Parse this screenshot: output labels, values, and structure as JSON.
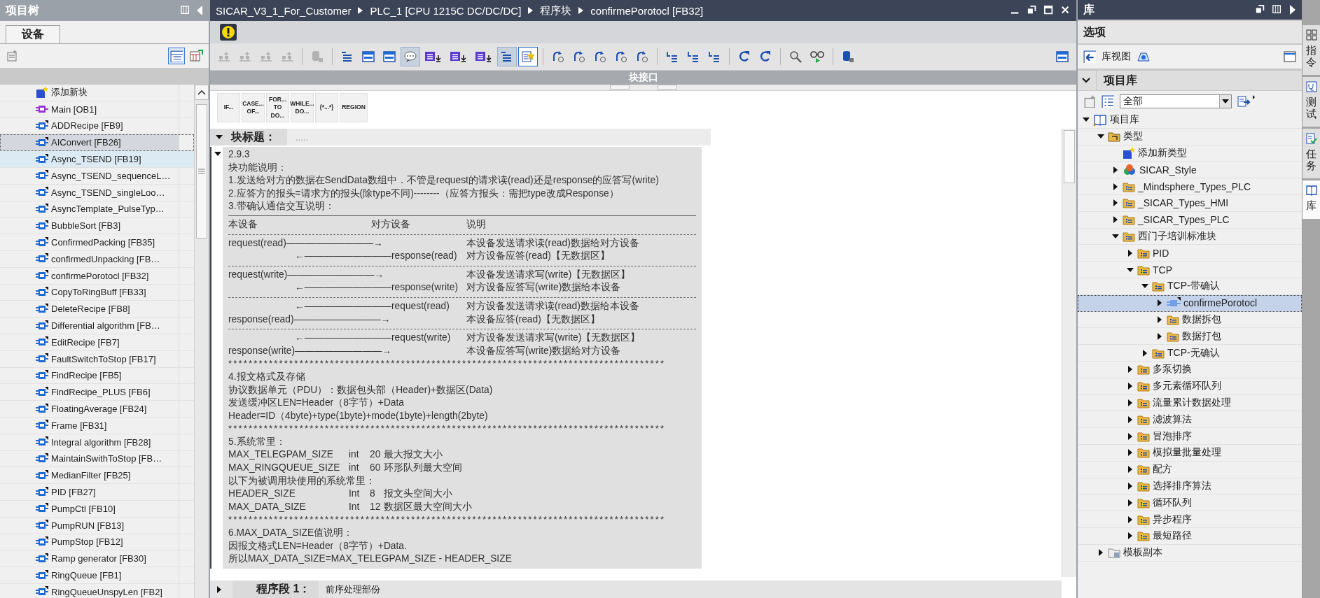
{
  "project_tree": {
    "title": "项目树",
    "tabs": [
      {
        "label": "设备",
        "selected": true
      }
    ],
    "items": [
      {
        "kind": "add",
        "label": "添加新块",
        "selected": false,
        "highlighted": false
      },
      {
        "kind": "ob",
        "label": "Main [OB1]",
        "selected": false,
        "highlighted": false
      },
      {
        "kind": "fb",
        "label": "ADDRecipe [FB9]",
        "selected": false,
        "highlighted": false
      },
      {
        "kind": "fb",
        "label": "AIConvert [FB26]",
        "selected": true,
        "highlighted": false
      },
      {
        "kind": "fb",
        "label": "Async_TSEND [FB19]",
        "selected": false,
        "highlighted": true
      },
      {
        "kind": "fb",
        "label": "Async_TSEND_sequenceL…",
        "selected": false,
        "highlighted": false
      },
      {
        "kind": "fb",
        "label": "Async_TSEND_singleLoo…",
        "selected": false,
        "highlighted": false
      },
      {
        "kind": "fb",
        "label": "AsyncTemplate_PulseTyp…",
        "selected": false,
        "highlighted": false
      },
      {
        "kind": "fb",
        "label": "BubbleSort [FB3]",
        "selected": false,
        "highlighted": false
      },
      {
        "kind": "fb",
        "label": "ConfirmedPacking [FB35]",
        "selected": false,
        "highlighted": false
      },
      {
        "kind": "fb",
        "label": "confirmedUnpacking [FB…",
        "selected": false,
        "highlighted": false
      },
      {
        "kind": "fb",
        "label": "confirmePorotocl [FB32]",
        "selected": false,
        "highlighted": false
      },
      {
        "kind": "fb",
        "label": "CopyToRingBuff [FB33]",
        "selected": false,
        "highlighted": false
      },
      {
        "kind": "fb",
        "label": "DeleteRecipe [FB8]",
        "selected": false,
        "highlighted": false
      },
      {
        "kind": "fb",
        "label": "Differential algorithm [FB…",
        "selected": false,
        "highlighted": false
      },
      {
        "kind": "fb",
        "label": "EditRecipe [FB7]",
        "selected": false,
        "highlighted": false
      },
      {
        "kind": "fb",
        "label": "FaultSwitchToStop [FB17]",
        "selected": false,
        "highlighted": false
      },
      {
        "kind": "fb",
        "label": "FindRecipe [FB5]",
        "selected": false,
        "highlighted": false
      },
      {
        "kind": "fb",
        "label": "FindRecipe_PLUS [FB6]",
        "selected": false,
        "highlighted": false
      },
      {
        "kind": "fb",
        "label": "FloatingAverage [FB24]",
        "selected": false,
        "highlighted": false
      },
      {
        "kind": "fb",
        "label": "Frame [FB31]",
        "selected": false,
        "highlighted": false
      },
      {
        "kind": "fb",
        "label": "Integral algorithm [FB28]",
        "selected": false,
        "highlighted": false
      },
      {
        "kind": "fb",
        "label": "MaintainSwithToStop [FB…",
        "selected": false,
        "highlighted": false
      },
      {
        "kind": "fb",
        "label": "MedianFilter [FB25]",
        "selected": false,
        "highlighted": false
      },
      {
        "kind": "fb",
        "label": "PID [FB27]",
        "selected": false,
        "highlighted": false
      },
      {
        "kind": "fb",
        "label": "PumpCtl [FB10]",
        "selected": false,
        "highlighted": false
      },
      {
        "kind": "fb",
        "label": "PumpRUN [FB13]",
        "selected": false,
        "highlighted": false
      },
      {
        "kind": "fb",
        "label": "PumpStop [FB12]",
        "selected": false,
        "highlighted": false
      },
      {
        "kind": "fb",
        "label": "Ramp generator [FB30]",
        "selected": false,
        "highlighted": false
      },
      {
        "kind": "fb",
        "label": "RingQueue [FB1]",
        "selected": false,
        "highlighted": false
      },
      {
        "kind": "fb",
        "label": "RingQueueUnspyLen [FB2]",
        "selected": false,
        "highlighted": false
      }
    ]
  },
  "editor": {
    "breadcrumb": [
      "SICAR_V3_1_For_Customer",
      "PLC_1 [CPU 1215C DC/DC/DC]",
      "程序块",
      "confirmePorotocl [FB32]"
    ],
    "toolbar": [
      [
        {
          "kind": "network",
          "pressed": false,
          "disabled": true
        },
        {
          "kind": "network",
          "pressed": false,
          "disabled": true
        },
        {
          "kind": "network",
          "pressed": false,
          "disabled": true
        },
        {
          "kind": "network",
          "pressed": false,
          "disabled": true
        }
      ],
      [
        {
          "kind": "cylinder",
          "pressed": false,
          "disabled": true
        }
      ],
      [
        {
          "kind": "lines",
          "pressed": false,
          "disabled": false
        },
        {
          "kind": "panel",
          "pressed": false,
          "disabled": false
        },
        {
          "kind": "panel",
          "pressed": false,
          "disabled": false
        },
        {
          "kind": "bubble",
          "pressed": true,
          "disabled": false
        },
        {
          "kind": "list-arrow",
          "pressed": false,
          "disabled": false
        },
        {
          "kind": "list-arrow",
          "pressed": false,
          "disabled": false
        },
        {
          "kind": "list-arrow",
          "pressed": false,
          "disabled": false
        },
        {
          "kind": "lines",
          "pressed": true,
          "disabled": false
        },
        {
          "kind": "star",
          "pressed": true,
          "disabled": false
        }
      ],
      [
        {
          "kind": "loop-arrow",
          "pressed": false,
          "disabled": false
        },
        {
          "kind": "loop-arrow",
          "pressed": false,
          "disabled": false
        },
        {
          "kind": "loop-arrow",
          "pressed": false,
          "disabled": false
        },
        {
          "kind": "loop-arrow",
          "pressed": false,
          "disabled": false
        },
        {
          "kind": "loop-arrow",
          "pressed": false,
          "disabled": false
        }
      ],
      [
        {
          "kind": "indent",
          "pressed": false,
          "disabled": false
        },
        {
          "kind": "indent",
          "pressed": false,
          "disabled": false
        },
        {
          "kind": "indent",
          "pressed": false,
          "disabled": false
        }
      ],
      [
        {
          "kind": "refresh",
          "pressed": false,
          "disabled": false
        },
        {
          "kind": "refresh",
          "pressed": false,
          "disabled": false
        }
      ],
      [
        {
          "kind": "magnifier",
          "pressed": false,
          "disabled": false
        },
        {
          "kind": "glasses",
          "pressed": false,
          "disabled": false
        }
      ],
      [
        {
          "kind": "cylinder",
          "pressed": false,
          "disabled": false
        }
      ]
    ],
    "toolbar_end": [
      {
        "kind": "panel",
        "pressed": false,
        "disabled": false
      }
    ],
    "interface_bar": "块接口",
    "snippets": [
      "IF...",
      "CASE...\nOF...",
      "FOR...\nTO DO...",
      "WHILE...\nDO...",
      "(*...*)",
      "REGION"
    ],
    "block_title": {
      "label": "块标题：",
      "placeholder": ".....",
      "expanded": true
    },
    "comment": {
      "expanded": true,
      "lines": [
        {
          "kind": "text",
          "text": "2.9.3"
        },
        {
          "kind": "text",
          "text": "块功能说明："
        },
        {
          "kind": "text",
          "text": "1.发送给对方的数据在SendData数组中．不管是request的请求读(read)还是response的应答写(write)"
        },
        {
          "kind": "text",
          "text": "2.应答方的报头=请求方的报头(除type不同)--------（应答方报头：需把type改成Response）"
        },
        {
          "kind": "text",
          "text": "3.带确认通信交互说明："
        },
        {
          "kind": "rule"
        },
        {
          "kind": "header",
          "cols": [
            "本设备",
            "对方设备",
            "说明"
          ]
        },
        {
          "kind": "dashes"
        },
        {
          "kind": "out",
          "flow": "request(read)—————————→",
          "text": "本设备发送请求读(read)数据给对方设备"
        },
        {
          "kind": "in",
          "flow": "←—————————response(read)",
          "text": "对方设备应答(read)【无数据区】"
        },
        {
          "kind": "dashes"
        },
        {
          "kind": "out",
          "flow": "request(write)—————————→",
          "text": "本设备发送请求写(write)【无数据区】"
        },
        {
          "kind": "in",
          "flow": "←—————————response(write)",
          "text": "对方设备应答写(write)数据给本设备"
        },
        {
          "kind": "dashes"
        },
        {
          "kind": "in",
          "flow": "←—————————request(read)",
          "text": "对方设备发送请求读(read)数据给本设备"
        },
        {
          "kind": "out",
          "flow": "response(read)—————————→",
          "text": "本设备应答(read)【无数据区】"
        },
        {
          "kind": "dashes"
        },
        {
          "kind": "in",
          "flow": "←—————————request(write)",
          "text": "对方设备发送请求写(write)【无数据区】"
        },
        {
          "kind": "out",
          "flow": "response(write)—————————→",
          "text": "本设备应答写(write)数据给对方设备"
        },
        {
          "kind": "stars",
          "text": "**************************************************************************************"
        },
        {
          "kind": "text",
          "text": "4.报文格式及存储"
        },
        {
          "kind": "text",
          "text": "协议数据单元（PDU）：数据包头部（Header)+数据区(Data)"
        },
        {
          "kind": "text",
          "text": "发送缓冲区LEN=Header（8字节）+Data"
        },
        {
          "kind": "text",
          "text": "Header=ID（4byte)+type(1byte)+mode(1byte)+length(2byte)"
        },
        {
          "kind": "stars",
          "text": "**************************************************************************************"
        },
        {
          "kind": "text",
          "text": "5.系统常里："
        },
        {
          "kind": "const",
          "cols": [
            "MAX_TELEGPAM_SIZE",
            "int",
            "20",
            "最大报文大小"
          ]
        },
        {
          "kind": "const",
          "cols": [
            "MAX_RINGQUEUE_SIZE",
            "int",
            "60",
            "环形队列最大空间"
          ]
        },
        {
          "kind": "text",
          "text": "以下为被调用块使用的系统常里："
        },
        {
          "kind": "const",
          "cols": [
            "HEADER_SIZE",
            "Int",
            "8",
            "报文头空间大小"
          ]
        },
        {
          "kind": "const",
          "cols": [
            "MAX_DATA_SIZE",
            "Int",
            "12",
            "数据区最大空间大小"
          ]
        },
        {
          "kind": "stars",
          "text": "**************************************************************************************"
        },
        {
          "kind": "text",
          "text": "6.MAX_DATA_SIZE值说明："
        },
        {
          "kind": "text",
          "text": "因报文格式LEN=Header（8字节）+Data."
        },
        {
          "kind": "text",
          "text": "所以MAX_DATA_SIZE=MAX_TELEGPAM_SIZE - HEADER_SIZE"
        }
      ]
    },
    "network": {
      "label": "程序段 1：",
      "title": "前序处理部份",
      "expanded": false
    }
  },
  "library": {
    "title": "库",
    "options_title": "选项",
    "view_button": "库视图",
    "section": {
      "title": "项目库",
      "expanded": true
    },
    "filter": "全部",
    "tree": [
      {
        "kind": "library",
        "label": "项目库",
        "expanded": true,
        "selected": false,
        "children": [
          {
            "kind": "types",
            "label": "类型",
            "expanded": true,
            "selected": false,
            "children": [
              {
                "kind": "add",
                "label": "添加新类型",
                "selected": false
              },
              {
                "kind": "style",
                "label": "SICAR_Style",
                "expanded": false,
                "selected": false
              },
              {
                "kind": "folder",
                "label": "_Mindsphere_Types_PLC",
                "expanded": false,
                "selected": false
              },
              {
                "kind": "folder",
                "label": "_SICAR_Types_HMI",
                "expanded": false,
                "selected": false
              },
              {
                "kind": "folder",
                "label": "_SICAR_Types_PLC",
                "expanded": false,
                "selected": false
              },
              {
                "kind": "folder",
                "label": "西门子培训标准块",
                "expanded": true,
                "selected": false,
                "children": [
                  {
                    "kind": "folder",
                    "label": "PID",
                    "expanded": false,
                    "selected": false
                  },
                  {
                    "kind": "folder",
                    "label": "TCP",
                    "expanded": true,
                    "selected": false,
                    "children": [
                      {
                        "kind": "folder",
                        "label": "TCP-带确认",
                        "expanded": true,
                        "selected": false,
                        "children": [
                          {
                            "kind": "block",
                            "label": "confirmePorotocl",
                            "expanded": false,
                            "selected": true
                          },
                          {
                            "kind": "folder",
                            "label": "数据拆包",
                            "expanded": false,
                            "selected": false
                          },
                          {
                            "kind": "folder",
                            "label": "数据打包",
                            "expanded": false,
                            "selected": false
                          }
                        ]
                      },
                      {
                        "kind": "folder",
                        "label": "TCP-无确认",
                        "expanded": false,
                        "selected": false
                      }
                    ]
                  },
                  {
                    "kind": "folder",
                    "label": "多泵切换",
                    "expanded": false,
                    "selected": false
                  },
                  {
                    "kind": "folder",
                    "label": "多元素循环队列",
                    "expanded": false,
                    "selected": false
                  },
                  {
                    "kind": "folder",
                    "label": "流量累计数据处理",
                    "expanded": false,
                    "selected": false
                  },
                  {
                    "kind": "folder",
                    "label": "滤波算法",
                    "expanded": false,
                    "selected": false
                  },
                  {
                    "kind": "folder",
                    "label": "冒泡排序",
                    "expanded": false,
                    "selected": false
                  },
                  {
                    "kind": "folder",
                    "label": "模拟量批量处理",
                    "expanded": false,
                    "selected": false
                  },
                  {
                    "kind": "folder",
                    "label": "配方",
                    "expanded": false,
                    "selected": false
                  },
                  {
                    "kind": "folder",
                    "label": "选择排序算法",
                    "expanded": false,
                    "selected": false
                  },
                  {
                    "kind": "folder",
                    "label": "循环队列",
                    "expanded": false,
                    "selected": false
                  },
                  {
                    "kind": "folder",
                    "label": "异步程序",
                    "expanded": false,
                    "selected": false
                  },
                  {
                    "kind": "folder",
                    "label": "最短路径",
                    "expanded": false,
                    "selected": false
                  }
                ]
              }
            ]
          },
          {
            "kind": "master",
            "label": "模板副本",
            "expanded": false,
            "selected": false
          }
        ]
      }
    ]
  },
  "side_tabs": [
    {
      "label": "指令",
      "selected": false
    },
    {
      "label": "测试",
      "selected": false
    },
    {
      "label": "任务",
      "selected": false
    },
    {
      "label": "库",
      "selected": true
    }
  ]
}
